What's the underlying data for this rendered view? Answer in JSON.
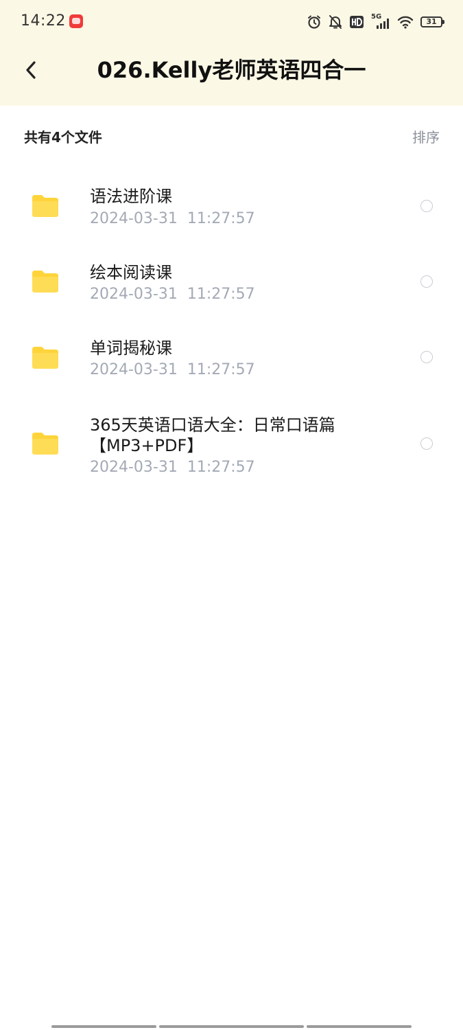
{
  "status_bar": {
    "time": "14:22",
    "network": "5G",
    "battery": "31"
  },
  "header": {
    "title": "026.Kelly老师英语四合一"
  },
  "summary": {
    "file_count_text": "共有4个文件",
    "sort_label": "排序"
  },
  "files": [
    {
      "name": "语法进阶课",
      "date": "2024-03-31  11:27:57"
    },
    {
      "name": "绘本阅读课",
      "date": "2024-03-31  11:27:57"
    },
    {
      "name": "单词揭秘课",
      "date": "2024-03-31  11:27:57"
    },
    {
      "name": "365天英语口语大全：日常口语篇【MP3+PDF】",
      "date": "2024-03-31  11:27:57"
    }
  ],
  "colors": {
    "header_background": "#fcf8e6",
    "folder": "#ffd43b",
    "date_text": "#a3a9b5",
    "sort_text": "#8a8f99"
  },
  "icons": {
    "back": "chevron-left-icon",
    "folder": "folder-icon",
    "alarm": "alarm-icon",
    "mute": "bell-off-icon",
    "hd": "hd-icon",
    "signal": "signal-icon",
    "wifi": "wifi-icon",
    "battery": "battery-icon"
  }
}
